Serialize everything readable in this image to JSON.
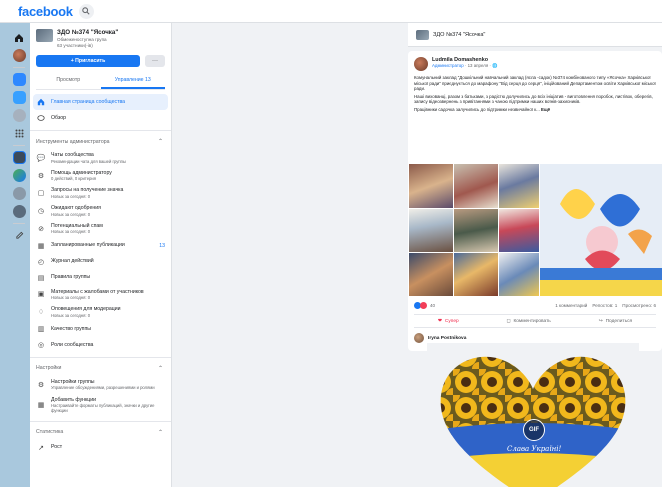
{
  "topbar": {
    "brand": "facebook"
  },
  "sidebar": {
    "group_name": "ЗДО №374 \"Ясочка\"",
    "group_privacy": "Обмеженоступна група",
    "group_members": "63 участники(-ів)",
    "invite_label": "+ Пригласить",
    "more_label": "···",
    "tabs": [
      {
        "label": "Просмотр"
      },
      {
        "label": "Управление 13"
      }
    ],
    "main_items": [
      {
        "label": "Главная страница сообщества"
      },
      {
        "label": "Обзор"
      }
    ],
    "admin_tools_title": "Инструменты администратора",
    "admin_tools": [
      {
        "label": "Чаты сообщества",
        "sub": "Рекомендации чата для вашей группы"
      },
      {
        "label": "Помощь администратору",
        "sub": "0 действий, 0 критерия"
      },
      {
        "label": "Запросы на получение значка",
        "sub": "Новых за сегодня: 0"
      },
      {
        "label": "Ожидают одобрения",
        "sub": "Новых за сегодня: 0"
      },
      {
        "label": "Потенциальный спам",
        "sub": "Новых за сегодня: 0"
      },
      {
        "label": "Запланированные публикации",
        "sub": "",
        "count": "13"
      },
      {
        "label": "Журнал действий",
        "sub": ""
      },
      {
        "label": "Правила группы",
        "sub": ""
      },
      {
        "label": "Материалы с жалобами от участников",
        "sub": "Новых за сегодня: 0"
      },
      {
        "label": "Оповещения для модерации",
        "sub": "Новых за сегодня: 0"
      },
      {
        "label": "Качество группы",
        "sub": ""
      },
      {
        "label": "Роли сообщества",
        "sub": ""
      }
    ],
    "settings_title": "Настройки",
    "settings": [
      {
        "label": "Настройки группы",
        "sub": "Управление обсуждениями, разрешениями и ролями"
      },
      {
        "label": "Добавить функции",
        "sub": "Настраивайте форматы публикаций, значки и другие функции"
      }
    ],
    "stats_title": "Статистика",
    "stats_first": "Рост"
  },
  "main": {
    "group_bar_name": "ЗДО №374 \"Ясочка\"",
    "post": {
      "author": "Ludmila Domashenko",
      "role": "Администратор",
      "time": "· 13 апреля ·",
      "paragraphs": [
        "Комунальний заклад \"Дошкільний навчальний заклад (ясла -садок) №374 комбінованого типу «Ясочка» Харківської міської ради\" приєднується до марафону \"Від серця до серця\", ініційований Департаментом освіти Харківської міської ради.",
        "Наші вихованці, разом з батьками, з радістю долучились до всіх ініціатив - виготовлення поробок, листівок, оберегів, запису відеозвернень з привітаннями з чаною підтримки наших воїнів-захисників.",
        "Працівники садочка залучились до підтримки незвичайної к..."
      ],
      "more": "Ещё",
      "reaction_count": "40",
      "comments_count": "1 комментарий",
      "reposts": "Репостов: 1",
      "views": "Просмотрено: 6",
      "like_label": "Супер",
      "comment_label": "Комментировать",
      "share_label": "Поделиться"
    },
    "comment": {
      "author": "Iryna Postnikova",
      "gif_label": "GIF",
      "gif_caption": "Слава Україні!"
    }
  },
  "colors": {
    "accent": "#1877f2",
    "sidebar_active_bg": "#e7f0fd",
    "page_bg": "#f0f2f5",
    "desktop_bg": "#a9c8dd"
  },
  "icons": {
    "home": "home-icon",
    "search": "search-icon",
    "overview": "overview-icon",
    "chevron": "chevron-up-icon"
  }
}
